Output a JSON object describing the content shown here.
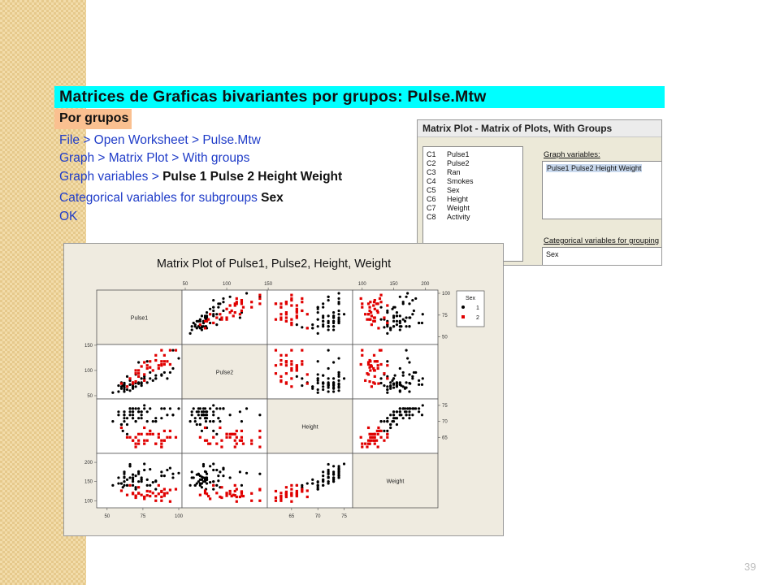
{
  "slide": {
    "title": "Matrices de Graficas bivariantes por grupos: Pulse.Mtw",
    "subtitle": "Por grupos",
    "steps": {
      "s1": "File > Open Worksheet > Pulse.Mtw",
      "s2": "Graph > Matrix Plot > With groups",
      "s3_prefix": "Graph variables > ",
      "s3_bold": "Pulse 1 Pulse 2 Height Weight",
      "s4_prefix": "Categorical variables for subgroups ",
      "s4_bold": "Sex",
      "s5": "OK"
    },
    "page_number": "39",
    "colors": {
      "title_bar": "#00ffff",
      "subtitle_bar": "#fac090",
      "step_text": "#1f3cc8"
    }
  },
  "dialog": {
    "title": "Matrix Plot - Matrix of Plots, With Groups",
    "columns": [
      {
        "col": "C1",
        "name": "Pulse1"
      },
      {
        "col": "C2",
        "name": "Pulse2"
      },
      {
        "col": "C3",
        "name": "Ran"
      },
      {
        "col": "C4",
        "name": "Smokes"
      },
      {
        "col": "C5",
        "name": "Sex"
      },
      {
        "col": "C6",
        "name": "Height"
      },
      {
        "col": "C7",
        "name": "Weight"
      },
      {
        "col": "C8",
        "name": "Activity"
      }
    ],
    "graph_variables_label": "Graph variables:",
    "graph_variables_value": "Pulse1 Pulse2 Height Weight",
    "categorical_label": "Categorical variables for grouping",
    "categorical_value": "Sex"
  },
  "chart_data": {
    "type": "scatter",
    "title": "Matrix Plot of Pulse1, Pulse2, Height, Weight",
    "variables": [
      "Pulse1",
      "Pulse2",
      "Height",
      "Weight"
    ],
    "legend": {
      "title": "Sex",
      "groups": [
        "1",
        "2"
      ],
      "symbols": [
        "circle",
        "square"
      ],
      "colors": [
        "#000000",
        "#e00000"
      ],
      "placement": "right"
    },
    "ticks": {
      "Pulse1": [
        "50",
        "75",
        "100"
      ],
      "Pulse2": [
        "50",
        "100",
        "150"
      ],
      "Height": [
        "65",
        "70",
        "75"
      ],
      "Weight": [
        "100",
        "150",
        "200"
      ]
    },
    "ranges": {
      "Pulse1": [
        45,
        100
      ],
      "Pulse2": [
        50,
        145
      ],
      "Height": [
        61,
        76
      ],
      "Weight": [
        90,
        215
      ]
    },
    "groups": [
      {
        "name": "1",
        "points": [
          [
            64,
            88,
            66,
            140
          ],
          [
            58,
            70,
            72,
            145
          ],
          [
            62,
            75,
            73,
            160
          ],
          [
            66,
            80,
            74,
            190
          ],
          [
            64,
            68,
            69,
            155
          ],
          [
            74,
            84,
            73,
            150
          ],
          [
            84,
            84,
            70,
            150
          ],
          [
            68,
            72,
            73,
            160
          ],
          [
            62,
            75,
            71,
            175
          ],
          [
            76,
            88,
            74,
            180
          ],
          [
            90,
            96,
            74,
            165
          ],
          [
            80,
            84,
            67,
            140
          ],
          [
            92,
            84,
            72,
            180
          ],
          [
            68,
            76,
            71,
            155
          ],
          [
            60,
            76,
            68,
            145
          ],
          [
            62,
            58,
            72,
            175
          ],
          [
            66,
            72,
            73,
            190
          ],
          [
            70,
            68,
            74,
            165
          ],
          [
            68,
            72,
            74,
            160
          ],
          [
            72,
            76,
            73,
            170
          ],
          [
            70,
            92,
            70,
            135
          ],
          [
            74,
            74,
            71,
            155
          ],
          [
            66,
            60,
            74,
            160
          ],
          [
            70,
            75,
            70,
            130
          ],
          [
            96,
            140,
            72,
            170
          ],
          [
            62,
            66,
            73,
            150
          ],
          [
            78,
            118,
            70,
            140
          ],
          [
            82,
            80,
            70,
            148
          ],
          [
            100,
            124,
            74,
            172
          ],
          [
            68,
            64,
            73,
            168
          ],
          [
            96,
            104,
            72,
            160
          ],
          [
            78,
            76,
            73,
            155
          ],
          [
            88,
            90,
            71,
            165
          ],
          [
            62,
            72,
            72,
            150
          ],
          [
            80,
            96,
            74,
            182
          ],
          [
            62,
            62,
            70,
            140
          ],
          [
            60,
            68,
            69,
            145
          ],
          [
            72,
            116,
            73,
            175
          ],
          [
            62,
            70,
            72,
            162
          ],
          [
            76,
            84,
            75,
            196
          ],
          [
            68,
            66,
            74,
            168
          ],
          [
            54,
            56,
            70,
            140
          ],
          [
            74,
            70,
            73,
            155
          ],
          [
            74,
            76,
            72,
            160
          ],
          [
            68,
            68,
            71,
            140
          ],
          [
            72,
            74,
            74,
            176
          ],
          [
            68,
            74,
            72,
            150
          ],
          [
            84,
            84,
            70,
            130
          ],
          [
            61,
            70,
            67,
            135
          ],
          [
            64,
            62,
            71,
            140
          ],
          [
            94,
            96,
            74,
            185
          ],
          [
            60,
            64,
            69,
            145
          ],
          [
            72,
            74,
            71,
            150
          ],
          [
            58,
            58,
            73,
            160
          ],
          [
            88,
            92,
            74,
            175
          ],
          [
            66,
            72,
            72,
            195
          ],
          [
            84,
            90,
            71,
            152
          ],
          [
            62,
            66,
            72,
            170
          ]
        ]
      },
      {
        "name": "2",
        "points": [
          [
            88,
            110,
            62,
            125
          ],
          [
            72,
            88,
            63,
            120
          ],
          [
            70,
            100,
            65,
            113
          ],
          [
            76,
            116,
            64,
            110
          ],
          [
            80,
            118,
            67,
            124
          ],
          [
            98,
            140,
            65,
            130
          ],
          [
            90,
            130,
            64,
            119
          ],
          [
            78,
            104,
            66,
            125
          ],
          [
            88,
            118,
            64,
            123
          ],
          [
            84,
            120,
            63,
            112
          ],
          [
            74,
            108,
            66,
            115
          ],
          [
            92,
            118,
            65,
            120
          ],
          [
            76,
            80,
            63,
            105
          ],
          [
            70,
            94,
            62,
            108
          ],
          [
            68,
            76,
            64,
            118
          ],
          [
            64,
            68,
            65,
            115
          ],
          [
            82,
            100,
            66,
            120
          ],
          [
            88,
            140,
            62,
            100
          ],
          [
            90,
            112,
            67,
            130
          ],
          [
            78,
            110,
            64,
            114
          ],
          [
            86,
            110,
            66,
            140
          ],
          [
            70,
            78,
            63,
            112
          ],
          [
            94,
            112,
            65,
            98
          ],
          [
            72,
            100,
            66,
            119
          ],
          [
            68,
            74,
            64,
            120
          ],
          [
            90,
            118,
            64,
            113
          ],
          [
            94,
            140,
            67,
            128
          ],
          [
            76,
            92,
            68,
            110
          ],
          [
            84,
            130,
            63,
            100
          ],
          [
            80,
            106,
            66,
            112
          ],
          [
            86,
            104,
            65,
            118
          ],
          [
            72,
            94,
            64,
            135
          ],
          [
            60,
            74,
            68,
            126
          ],
          [
            66,
            84,
            65,
            140
          ],
          [
            88,
            112,
            63,
            110
          ]
        ]
      }
    ]
  }
}
